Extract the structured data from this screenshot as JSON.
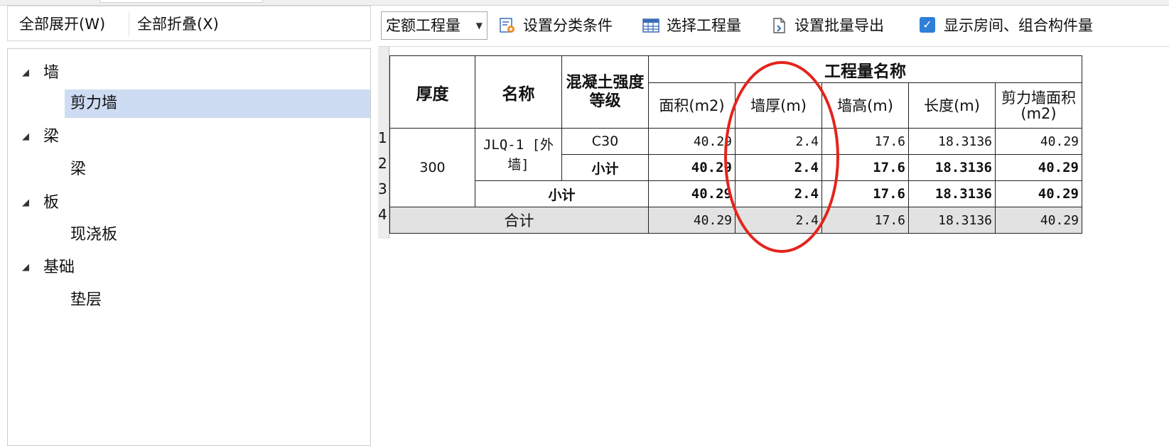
{
  "left_toolbar": {
    "expand_all": "全部展开(W)",
    "collapse_all": "全部折叠(X)"
  },
  "tree": {
    "groups": [
      {
        "label": "墙",
        "children": [
          "剪力墙"
        ]
      },
      {
        "label": "梁",
        "children": [
          "梁"
        ]
      },
      {
        "label": "板",
        "children": [
          "现浇板"
        ]
      },
      {
        "label": "基础",
        "children": [
          "垫层"
        ]
      }
    ],
    "selected": "剪力墙"
  },
  "toolbar": {
    "select_value": "定额工程量",
    "classify_label": "设置分类条件",
    "select_quantity_label": "选择工程量",
    "batch_export_label": "设置批量导出",
    "show_rooms_label": "显示房间、组合构件量",
    "show_rooms_checked": true
  },
  "table": {
    "header": {
      "thickness": "厚度",
      "name": "名称",
      "grade": "混凝土强度等级",
      "group": "工程量名称",
      "cols": [
        "面积(m2)",
        "墙厚(m)",
        "墙高(m)",
        "长度(m)",
        "剪力墙面积(m2)"
      ]
    },
    "row_numbers": [
      "1",
      "2",
      "3",
      "4"
    ],
    "thickness_value": "300",
    "name_value": "JLQ-1 [外墙]",
    "rows": [
      {
        "grade": "C30",
        "values": [
          "40.29",
          "2.4",
          "17.6",
          "18.3136",
          "40.29"
        ]
      },
      {
        "grade": "小计",
        "values": [
          "40.29",
          "2.4",
          "17.6",
          "18.3136",
          "40.29"
        ]
      },
      {
        "label": "小计",
        "values": [
          "40.29",
          "2.4",
          "17.6",
          "18.3136",
          "40.29"
        ]
      },
      {
        "label": "合计",
        "values": [
          "40.29",
          "2.4",
          "17.6",
          "18.3136",
          "40.29"
        ]
      }
    ]
  },
  "colors": {
    "selection": "#cddcf2",
    "annotation": "#e3241b",
    "checkbox": "#2f7fd8",
    "total_row": "#e2e2e2"
  },
  "icons": [
    "tree-collapse-arrow-icon",
    "classify-gear-icon",
    "table-grid-icon",
    "export-document-icon",
    "checkbox-checked-icon",
    "dropdown-caret-icon"
  ]
}
